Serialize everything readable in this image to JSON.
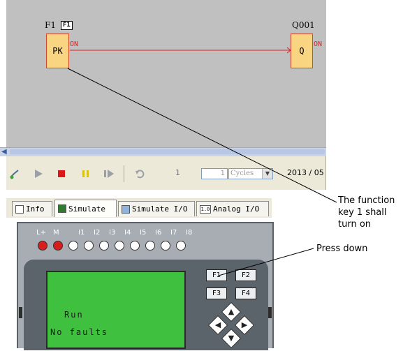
{
  "diagram": {
    "block1": {
      "name": "F1",
      "tag": "F1",
      "text": "PK",
      "output": "ON"
    },
    "block2": {
      "name": "Q001",
      "text": "Q",
      "output": "ON"
    }
  },
  "toolbar": {
    "step_value": "1",
    "cycles_value": "1",
    "cycles_unit": "Cycles",
    "date": "2013 / 05"
  },
  "tabs": [
    {
      "label": "Info",
      "icon": "info-doc-icon"
    },
    {
      "label": "Simulate",
      "icon": "simulate-icon"
    },
    {
      "label": "Simulate I/O",
      "icon": "simulate-io-icon"
    },
    {
      "label": "Analog I/O",
      "icon": "analog-io-icon",
      "icon_text": "1.0"
    }
  ],
  "device": {
    "terminals": [
      "L+",
      "M",
      "I1",
      "I2",
      "I3",
      "I4",
      "I5",
      "I6",
      "I7",
      "I8"
    ],
    "led_states": [
      "on",
      "on",
      "off",
      "off",
      "off",
      "off",
      "off",
      "off",
      "off",
      "off"
    ],
    "lcd_line1": "Run",
    "lcd_line2": "No faults",
    "function_keys": [
      "F1",
      "F2",
      "F3",
      "F4"
    ]
  },
  "annotations": {
    "function_key_note": "The function\nkey 1 shall\nturn on",
    "press_down_note": "Press down"
  },
  "colors": {
    "canvas_bg": "#c0c0c0",
    "block_fill": "#f9d581",
    "wire": "#d22",
    "led_on": "#d91c1c",
    "lcd": "#3fc03f"
  }
}
